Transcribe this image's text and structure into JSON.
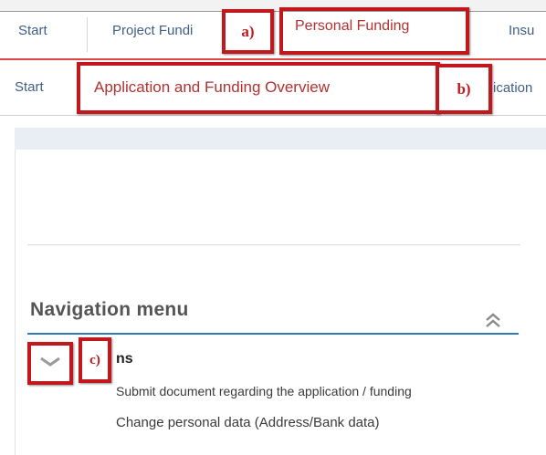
{
  "top_tabs": {
    "start": "Start",
    "project_funding": "Project Fundi",
    "personal_funding": "Personal Funding",
    "insurance": "Insu"
  },
  "sub_tabs": {
    "start": "Start",
    "overview": "Application and Funding Overview",
    "next": "ication"
  },
  "markers": {
    "a": "a)",
    "b": "b)",
    "c": "c)"
  },
  "nav": {
    "title": "Navigation menu",
    "options_label": "ns",
    "items": [
      "Submit document regarding the application / funding",
      "Change personal data (Address/Bank data)"
    ]
  },
  "colors": {
    "highlight_red": "#c0181c",
    "tab_blue": "#3f5f86",
    "active_tab": "#b2322f",
    "nav_underline": "#2f7bbf"
  }
}
